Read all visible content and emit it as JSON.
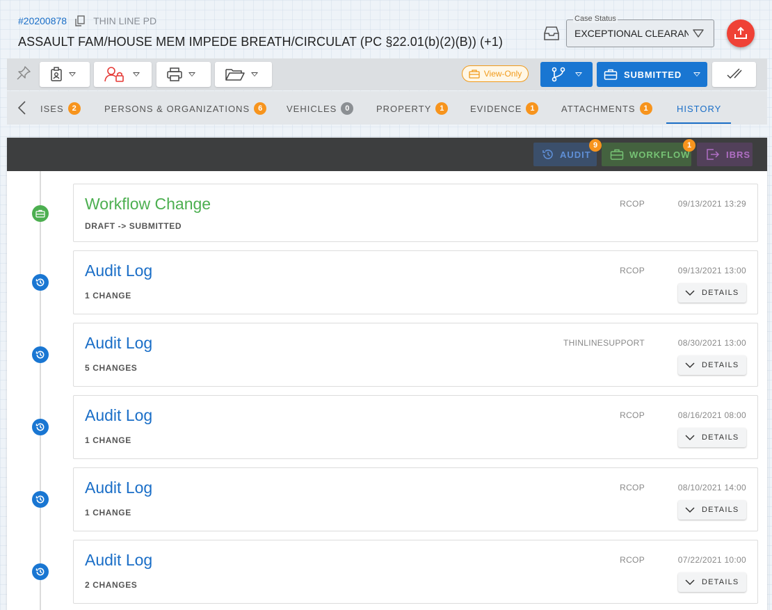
{
  "header": {
    "case_number": "#20200878",
    "agency": "THIN LINE PD",
    "title": "ASSAULT FAM/HOUSE MEM IMPEDE BREATH/CIRCULAT (PC §22.01(b)(2)(B)) (+1)",
    "case_status_label": "Case Status",
    "case_status_value": "EXCEPTIONAL CLEARANCE"
  },
  "toolbar": {
    "view_only_label": "View-Only",
    "submitted_label": "SUBMITTED"
  },
  "tabs": [
    {
      "label": "ISES",
      "count": "2"
    },
    {
      "label": "PERSONS & ORGANIZATIONS",
      "count": "6"
    },
    {
      "label": "VEHICLES",
      "count": "0"
    },
    {
      "label": "PROPERTY",
      "count": "1"
    },
    {
      "label": "EVIDENCE",
      "count": "1"
    },
    {
      "label": "ATTACHMENTS",
      "count": "1"
    },
    {
      "label": "HISTORY",
      "count": ""
    }
  ],
  "filters": [
    {
      "label": "AUDIT",
      "count": "9"
    },
    {
      "label": "WORKFLOW",
      "count": "1"
    },
    {
      "label": "IBRS",
      "count": ""
    }
  ],
  "details_label": "DETAILS",
  "history": [
    {
      "title": "Workflow Change",
      "user": "RCOP",
      "time": "09/13/2021 13:29",
      "sub": "DRAFT -> SUBMITTED"
    },
    {
      "title": "Audit Log",
      "user": "RCOP",
      "time": "09/13/2021 13:00",
      "sub": "1 CHANGE"
    },
    {
      "title": "Audit Log",
      "user": "THINLINESUPPORT",
      "time": "08/30/2021 13:00",
      "sub": "5 CHANGES"
    },
    {
      "title": "Audit Log",
      "user": "RCOP",
      "time": "08/16/2021 08:00",
      "sub": "1 CHANGE"
    },
    {
      "title": "Audit Log",
      "user": "RCOP",
      "time": "08/10/2021 14:00",
      "sub": "1 CHANGE"
    },
    {
      "title": "Audit Log",
      "user": "RCOP",
      "time": "07/22/2021 10:00",
      "sub": "2 CHANGES"
    }
  ]
}
